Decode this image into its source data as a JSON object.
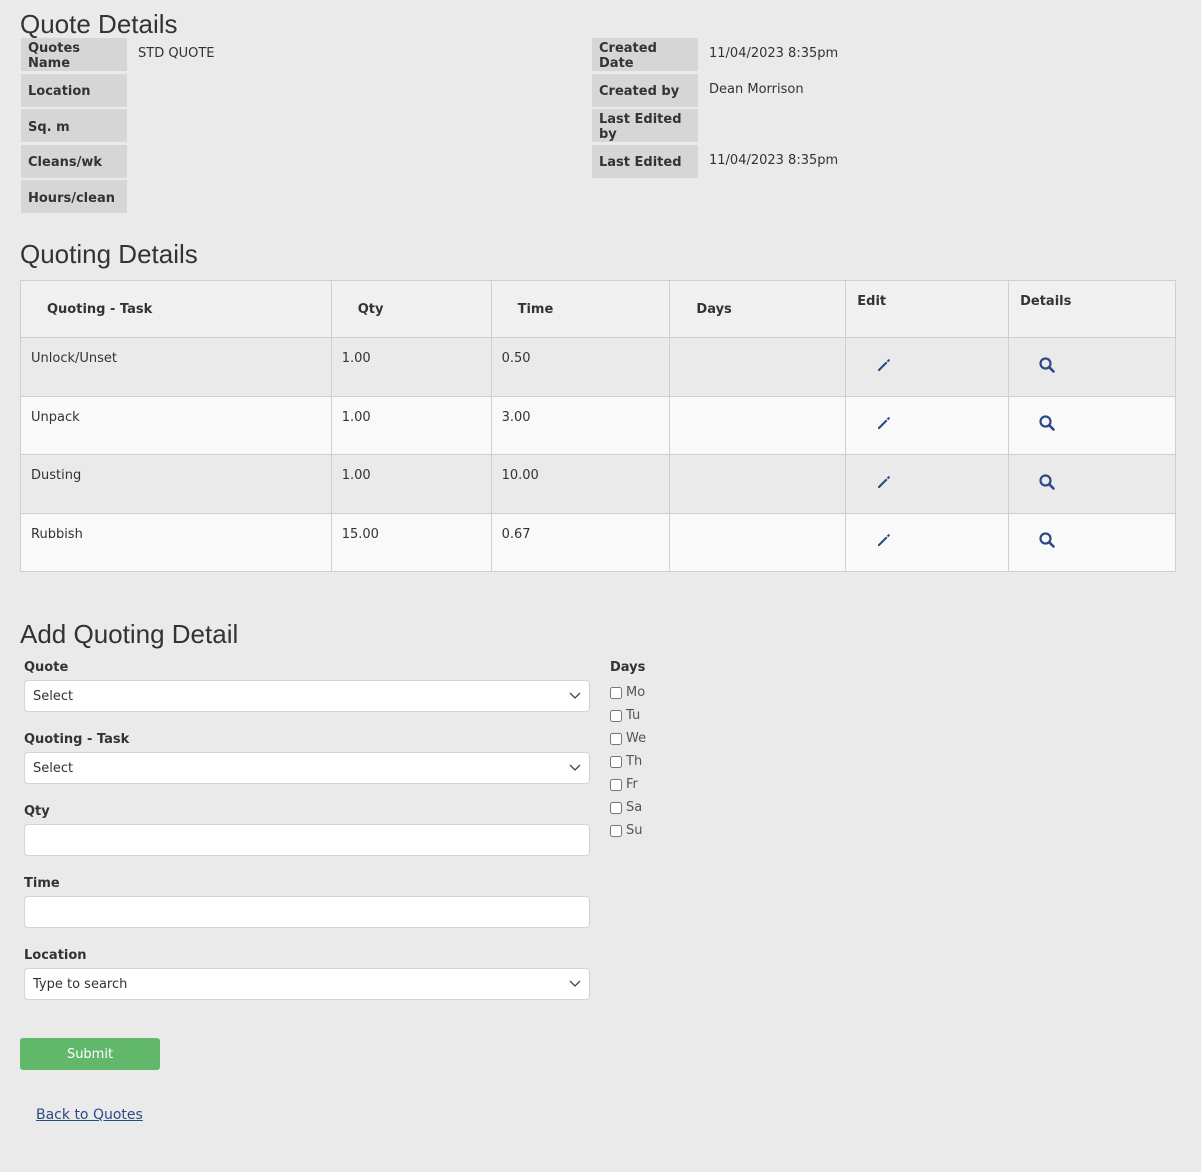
{
  "quote_details": {
    "title": "Quote Details",
    "left": [
      {
        "label": "Quotes Name",
        "value": "STD QUOTE"
      },
      {
        "label": "Location",
        "value": ""
      },
      {
        "label": "Sq. m",
        "value": ""
      },
      {
        "label": "Cleans/wk",
        "value": ""
      },
      {
        "label": "Hours/clean",
        "value": ""
      }
    ],
    "right": [
      {
        "label": "Created Date",
        "value": "11/04/2023 8:35pm"
      },
      {
        "label": "Created by",
        "value": "Dean Morrison"
      },
      {
        "label": "Last Edited by",
        "value": ""
      },
      {
        "label": "Last Edited",
        "value": "11/04/2023 8:35pm"
      }
    ]
  },
  "quoting_details": {
    "title": "Quoting Details",
    "columns": [
      "Quoting - Task",
      "Qty",
      "Time",
      "Days",
      "Edit",
      "Details"
    ],
    "rows": [
      {
        "task": "Unlock/Unset",
        "qty": "1.00",
        "time": "0.50",
        "days": ""
      },
      {
        "task": "Unpack",
        "qty": "1.00",
        "time": "3.00",
        "days": ""
      },
      {
        "task": "Dusting",
        "qty": "1.00",
        "time": "10.00",
        "days": ""
      },
      {
        "task": "Rubbish",
        "qty": "15.00",
        "time": "0.67",
        "days": ""
      }
    ],
    "icons": {
      "edit": "pencil-icon",
      "details": "magnifier-icon"
    }
  },
  "add_form": {
    "title": "Add Quoting Detail",
    "quote_label": "Quote",
    "quote_value": "Select",
    "task_label": "Quoting - Task",
    "task_value": "Select",
    "qty_label": "Qty",
    "qty_value": "",
    "time_label": "Time",
    "time_value": "",
    "location_label": "Location",
    "location_placeholder": "Type to search",
    "days_label": "Days",
    "days": [
      "Mo",
      "Tu",
      "We",
      "Th",
      "Fr",
      "Sa",
      "Su"
    ],
    "submit_label": "Submit"
  },
  "back_link": "Back to Quotes",
  "colors": {
    "background": "#eaeaea",
    "label_bg": "#d6d6d6",
    "submit": "#62b86a",
    "link": "#2a4a87",
    "icon": "#2a4a87"
  }
}
